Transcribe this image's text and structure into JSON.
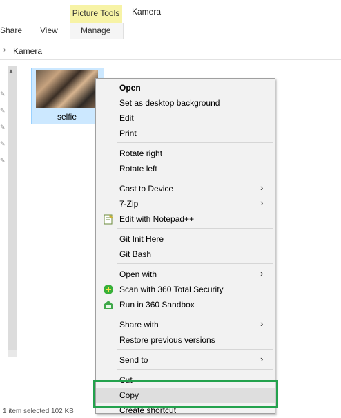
{
  "ribbon": {
    "context_tab": "Picture Tools",
    "window_title": "Kamera",
    "tabs": [
      "Share",
      "View",
      "Manage"
    ]
  },
  "address": {
    "path": "Kamera"
  },
  "file": {
    "name": "selfie"
  },
  "status": {
    "text": "1 item selected 102 KB"
  },
  "menu": {
    "open": "Open",
    "set_desktop": "Set as desktop background",
    "edit": "Edit",
    "print": "Print",
    "rotate_right": "Rotate right",
    "rotate_left": "Rotate left",
    "cast": "Cast to Device",
    "zip": "7-Zip",
    "notepad": "Edit with Notepad++",
    "git_init": "Git Init Here",
    "git_bash": "Git Bash",
    "open_with": "Open with",
    "scan_360": "Scan with 360 Total Security",
    "run_360": "Run in 360 Sandbox",
    "share_with": "Share with",
    "restore": "Restore previous versions",
    "send_to": "Send to",
    "cut": "Cut",
    "copy": "Copy",
    "create_shortcut": "Create shortcut"
  },
  "icons": {
    "submenu": "chevron-right-icon",
    "notepad": "notepad-plus-plus-icon",
    "scan": "360-security-icon",
    "sandbox": "360-sandbox-icon"
  },
  "colors": {
    "highlight_box": "#23a24d",
    "context_tab": "#f7f3a6",
    "selection": "#cce8ff"
  }
}
